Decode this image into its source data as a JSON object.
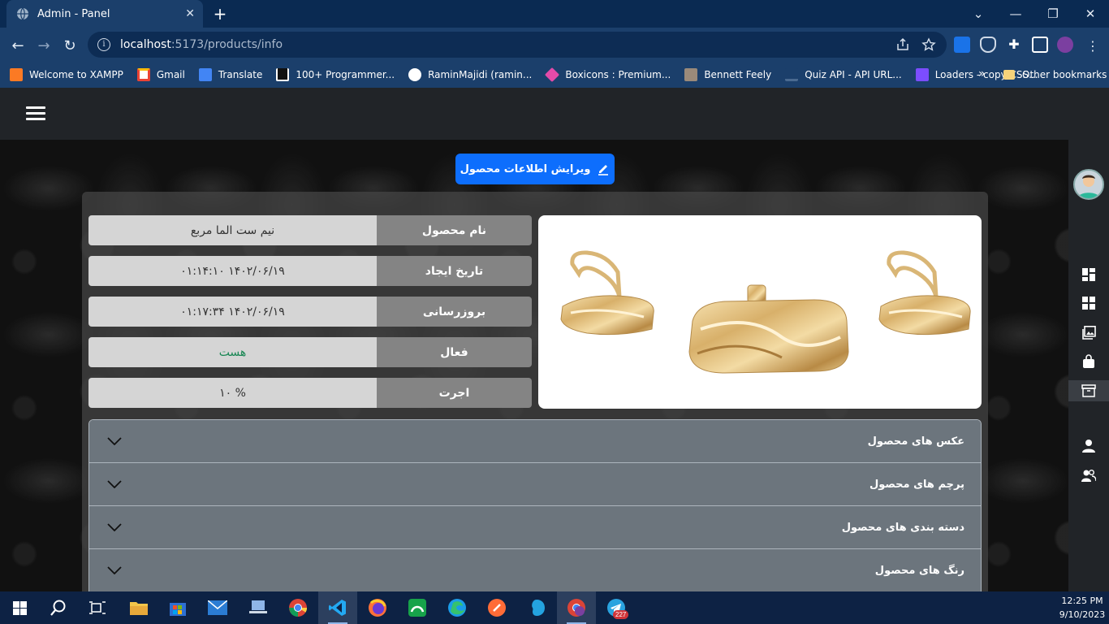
{
  "browser": {
    "tab_title": "Admin - Panel",
    "url_host": "localhost",
    "url_path": ":5173/products/info",
    "bookmarks": [
      {
        "label": "Welcome to XAMPP",
        "icon": "xampp-icon",
        "color": "#fb7a24"
      },
      {
        "label": "Gmail",
        "icon": "gmail-icon",
        "color": "#ea4335"
      },
      {
        "label": "Translate",
        "icon": "translate-icon",
        "color": "#4285f4"
      },
      {
        "label": "100+ Programmer...",
        "icon": "programmer-icon",
        "color": "#111111"
      },
      {
        "label": "RaminMajidi (ramin...",
        "icon": "github-icon",
        "color": "#ffffff"
      },
      {
        "label": "Boxicons : Premium...",
        "icon": "boxicons-icon",
        "color": "#e34ba9"
      },
      {
        "label": "Bennett Feely",
        "icon": "bennett-icon",
        "color": "#9a8a7a"
      },
      {
        "label": "Quiz API - API URL...",
        "icon": "quizapi-icon",
        "color": "#1b3f6b"
      },
      {
        "label": "Loaders - copy CSS...",
        "icon": "loaders-icon",
        "color": "#7c4dff"
      }
    ],
    "more_bookmarks": "»",
    "other_bookmarks": "Other bookmarks"
  },
  "page": {
    "edit_button": "ویرایش اطلاعات محصول",
    "info_rows": [
      {
        "label": "نام محصول",
        "value": "نیم ست الما مربع"
      },
      {
        "label": "تاریخ ایجاد",
        "value": "۱۴۰۲/۰۶/۱۹ ۰۱:۱۴:۱۰"
      },
      {
        "label": "بروزرسانی",
        "value": "۱۴۰۲/۰۶/۱۹ ۰۱:۱۷:۳۴"
      },
      {
        "label": "فعال",
        "value": "هست"
      },
      {
        "label": "اجرت",
        "value": "% ۱۰"
      }
    ],
    "accordion": [
      {
        "title": "عکس های محصول"
      },
      {
        "title": "پرچم های محصول"
      },
      {
        "title": "دسته بندی های محصول"
      },
      {
        "title": "رنگ های محصول"
      }
    ],
    "colors": {
      "primary": "#0d6efd",
      "active_green": "#198754"
    }
  },
  "taskbar": {
    "time": "12:25 PM",
    "date": "9/10/2023",
    "telegram_badge": "227"
  }
}
